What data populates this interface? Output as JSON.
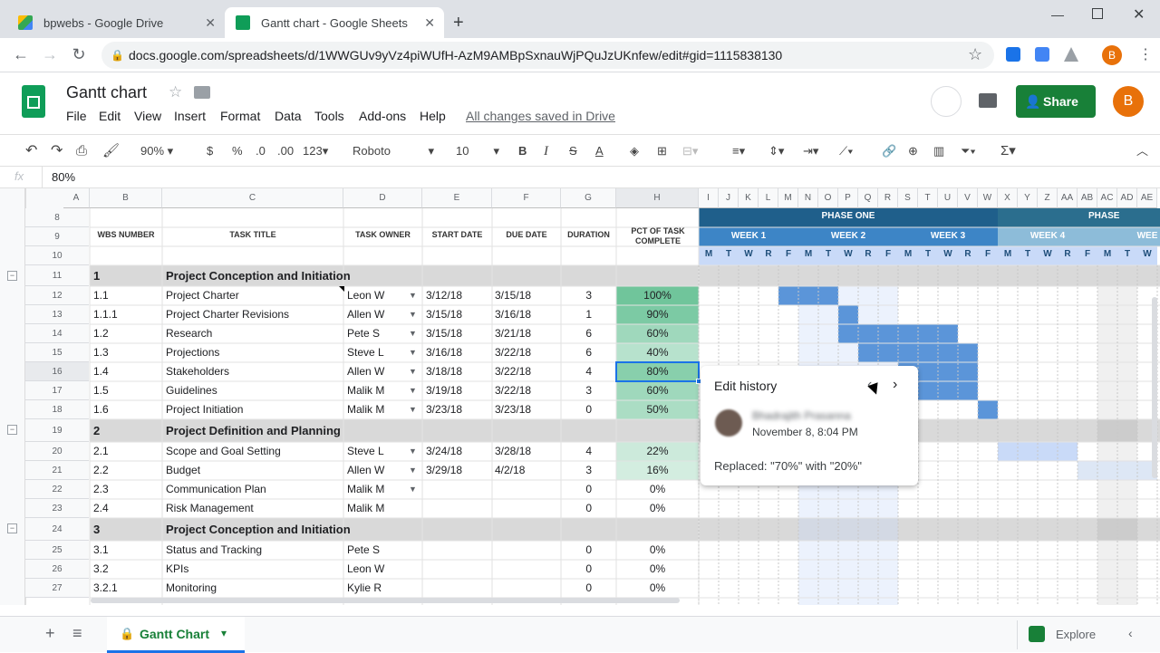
{
  "browser": {
    "tabs": [
      {
        "label": "bpwebs - Google Drive"
      },
      {
        "label": "Gantt chart - Google Sheets"
      }
    ],
    "url": "docs.google.com/spreadsheets/d/1WWGUv9yVz4piWUfH-AzM9AMBpSxnauWjPQuJzUKnfew/edit#gid=1115838130",
    "profile_letter": "B"
  },
  "app": {
    "title": "Gantt chart",
    "menus": [
      "File",
      "Edit",
      "View",
      "Insert",
      "Format",
      "Data",
      "Tools",
      "Add-ons",
      "Help"
    ],
    "saved_status": "All changes saved in Drive",
    "share_label": "Share",
    "avatar_letter": "B"
  },
  "toolbar": {
    "zoom": "90%",
    "currency": "$",
    "percent": "%",
    "dec_dec": ".0",
    "dec_inc": ".00",
    "format": "123",
    "font": "Roboto",
    "font_size": "10"
  },
  "formula_bar": {
    "fx": "fx",
    "value": "80%"
  },
  "columns": {
    "main": [
      "A",
      "B",
      "C",
      "D",
      "E",
      "F",
      "G",
      "H"
    ],
    "gantt": [
      "I",
      "J",
      "K",
      "L",
      "M",
      "N",
      "O",
      "P",
      "Q",
      "R",
      "S",
      "T",
      "U",
      "V",
      "W",
      "X",
      "Y",
      "Z",
      "AA",
      "AB",
      "AC",
      "AD",
      "AE"
    ]
  },
  "header": {
    "wbs": "WBS NUMBER",
    "title": "TASK TITLE",
    "owner": "TASK OWNER",
    "start": "START DATE",
    "due": "DUE DATE",
    "duration": "DURATION",
    "pct": "PCT OF TASK COMPLETE",
    "phase": "PHASE ONE",
    "phase2": "PHASE",
    "weeks": [
      "WEEK 1",
      "WEEK 2",
      "WEEK 3",
      "WEEK 4",
      "WEE"
    ],
    "days": [
      "M",
      "T",
      "W",
      "R",
      "F",
      "M",
      "T",
      "W",
      "R",
      "F",
      "M",
      "T",
      "W",
      "R",
      "F",
      "M",
      "T",
      "W",
      "R",
      "F",
      "M",
      "T",
      "W"
    ]
  },
  "rows": [
    {
      "n": "8",
      "type": "blank"
    },
    {
      "n": "9",
      "type": "blank"
    },
    {
      "n": "10",
      "type": "blank"
    },
    {
      "n": "11",
      "type": "section",
      "wbs": "1",
      "title": "Project Conception and Initiation"
    },
    {
      "n": "12",
      "wbs": "1.1",
      "title": "Project Charter",
      "owner": "Leon W",
      "start": "3/12/18",
      "due": "3/15/18",
      "dur": "3",
      "pct": "100%",
      "pctv": 1.0
    },
    {
      "n": "13",
      "wbs": "1.1.1",
      "title": "Project Charter Revisions",
      "owner": "Allen W",
      "start": "3/15/18",
      "due": "3/16/18",
      "dur": "1",
      "pct": "90%",
      "pctv": 0.9
    },
    {
      "n": "14",
      "wbs": "1.2",
      "title": "Research",
      "owner": "Pete S",
      "start": "3/15/18",
      "due": "3/21/18",
      "dur": "6",
      "pct": "60%",
      "pctv": 0.6
    },
    {
      "n": "15",
      "wbs": "1.3",
      "title": "Projections",
      "owner": "Steve L",
      "start": "3/16/18",
      "due": "3/22/18",
      "dur": "6",
      "pct": "40%",
      "pctv": 0.4
    },
    {
      "n": "16",
      "wbs": "1.4",
      "title": "Stakeholders",
      "owner": "Allen W",
      "start": "3/18/18",
      "due": "3/22/18",
      "dur": "4",
      "pct": "80%",
      "pctv": 0.8
    },
    {
      "n": "17",
      "wbs": "1.5",
      "title": "Guidelines",
      "owner": "Malik M",
      "start": "3/19/18",
      "due": "3/22/18",
      "dur": "3",
      "pct": "60%",
      "pctv": 0.6
    },
    {
      "n": "18",
      "wbs": "1.6",
      "title": "Project Initiation",
      "owner": "Malik M",
      "start": "3/23/18",
      "due": "3/23/18",
      "dur": "0",
      "pct": "50%",
      "pctv": 0.5
    },
    {
      "n": "19",
      "type": "section",
      "wbs": "2",
      "title": "Project Definition and Planning"
    },
    {
      "n": "20",
      "wbs": "2.1",
      "title": "Scope and Goal Setting",
      "owner": "Steve L",
      "start": "3/24/18",
      "due": "3/28/18",
      "dur": "4",
      "pct": "22%",
      "pctv": 0.22
    },
    {
      "n": "21",
      "wbs": "2.2",
      "title": "Budget",
      "owner": "Allen W",
      "start": "3/29/18",
      "due": "4/2/18",
      "dur": "3",
      "pct": "16%",
      "pctv": 0.16
    },
    {
      "n": "22",
      "wbs": "2.3",
      "title": "Communication Plan",
      "owner": "Malik M",
      "start": "",
      "due": "",
      "dur": "0",
      "pct": "0%",
      "pctv": 0
    },
    {
      "n": "23",
      "wbs": "2.4",
      "title": "Risk Management",
      "owner": "Malik M",
      "start": "",
      "due": "",
      "dur": "0",
      "pct": "0%",
      "pctv": 0
    },
    {
      "n": "24",
      "type": "section",
      "wbs": "3",
      "title": "Project Conception and Initiation"
    },
    {
      "n": "25",
      "wbs": "3.1",
      "title": "Status and Tracking",
      "owner": "Pete S",
      "start": "",
      "due": "",
      "dur": "0",
      "pct": "0%",
      "pctv": 0
    },
    {
      "n": "26",
      "wbs": "3.2",
      "title": "KPIs",
      "owner": "Leon W",
      "start": "",
      "due": "",
      "dur": "0",
      "pct": "0%",
      "pctv": 0
    },
    {
      "n": "27",
      "wbs": "3.2.1",
      "title": "Monitoring",
      "owner": "Kylie R",
      "start": "",
      "due": "",
      "dur": "0",
      "pct": "0%",
      "pctv": 0
    }
  ],
  "popup": {
    "title": "Edit history",
    "user": "Bhadrajith Prasanna",
    "date": "November 8, 8:04 PM",
    "change": "Replaced: \"70%\" with \"20%\""
  },
  "sheet": {
    "tab": "Gantt Chart",
    "explore": "Explore"
  },
  "colors": {
    "accent": "#1a73e8",
    "sheets_green": "#188038",
    "phase": "#1f6b9c",
    "week": "#3d85c6",
    "bar": "#5b95d9"
  }
}
